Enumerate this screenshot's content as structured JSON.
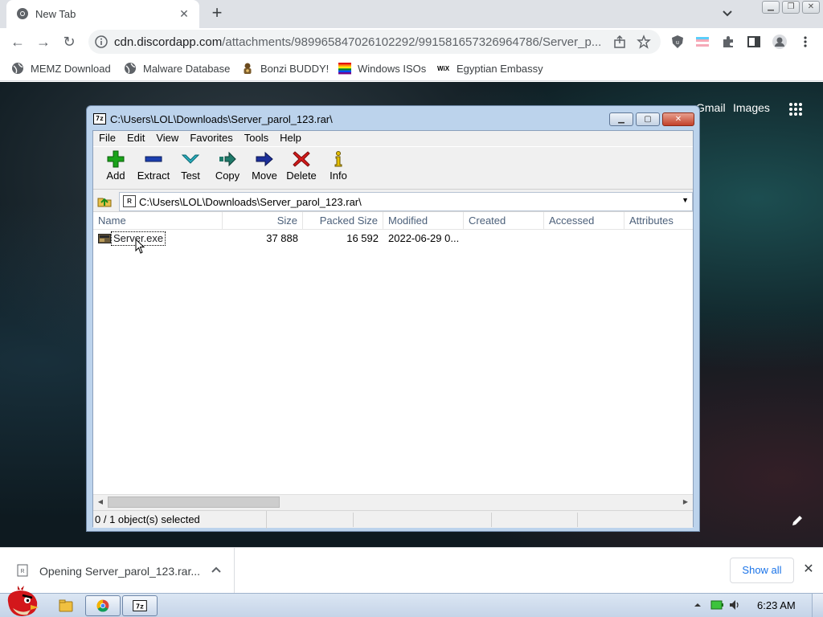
{
  "browser": {
    "tab": {
      "title": "New Tab"
    },
    "omnibox": {
      "host": "cdn.discordapp.com",
      "path": "/attachments/989965847026102292/991581657326964786/Server_p..."
    },
    "bookmarks": [
      {
        "label": "MEMZ Download",
        "icon": "globe-icon"
      },
      {
        "label": "Malware Database",
        "icon": "globe-icon"
      },
      {
        "label": "Bonzi BUDDY!",
        "icon": "bonzi-icon"
      },
      {
        "label": "Windows ISOs",
        "icon": "windows-flag-icon"
      },
      {
        "label": "Egyptian Embassy",
        "icon": "wix-icon"
      }
    ]
  },
  "google": {
    "gmail": "Gmail",
    "images": "Images"
  },
  "sevenzip": {
    "title": "C:\\Users\\LOL\\Downloads\\Server_parol_123.rar\\",
    "menu": [
      "File",
      "Edit",
      "View",
      "Favorites",
      "Tools",
      "Help"
    ],
    "toolbar": [
      {
        "label": "Add",
        "icon": "add-icon",
        "color": "#1aa31a"
      },
      {
        "label": "Extract",
        "icon": "extract-icon",
        "color": "#1c3fb0"
      },
      {
        "label": "Test",
        "icon": "test-icon",
        "color": "#2bb0c0"
      },
      {
        "label": "Copy",
        "icon": "copy-icon",
        "color": "#1f7a6a"
      },
      {
        "label": "Move",
        "icon": "move-icon",
        "color": "#1c2f9a"
      },
      {
        "label": "Delete",
        "icon": "delete-icon",
        "color": "#d41a1a"
      },
      {
        "label": "Info",
        "icon": "info-icon",
        "color": "#c9a400"
      }
    ],
    "address": "C:\\Users\\LOL\\Downloads\\Server_parol_123.rar\\",
    "columns": [
      "Name",
      "Size",
      "Packed Size",
      "Modified",
      "Created",
      "Accessed",
      "Attributes"
    ],
    "rows": [
      {
        "name": "Server.exe",
        "size": "37 888",
        "packed": "16 592",
        "modified": "2022-06-29 0...",
        "created": "",
        "accessed": "",
        "attributes": ""
      }
    ],
    "status": "0 / 1 object(s) selected"
  },
  "download": {
    "text": "Opening Server_parol_123.rar...",
    "show_all": "Show all"
  },
  "taskbar": {
    "time": "6:23 AM"
  }
}
